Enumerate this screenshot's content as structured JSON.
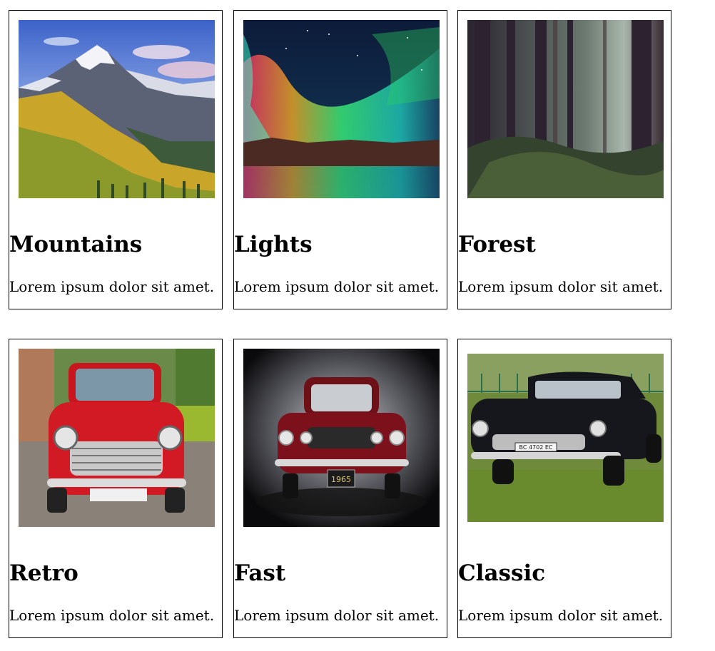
{
  "cards": [
    {
      "title": "Mountains",
      "text": "Lorem ipsum dolor sit amet.",
      "image": "mountains-photo"
    },
    {
      "title": "Lights",
      "text": "Lorem ipsum dolor sit amet.",
      "image": "aurora-photo"
    },
    {
      "title": "Forest",
      "text": "Lorem ipsum dolor sit amet.",
      "image": "forest-photo"
    },
    {
      "title": "Retro",
      "text": "Lorem ipsum dolor sit amet.",
      "image": "red-mini-car-photo"
    },
    {
      "title": "Fast",
      "text": "Lorem ipsum dolor sit amet.",
      "image": "red-mustang-photo"
    },
    {
      "title": "Classic",
      "text": "Lorem ipsum dolor sit amet.",
      "image": "black-classic-car-photo",
      "plate": "BC 4702 EC"
    }
  ],
  "mustang_plate": "1965",
  "colors": {
    "border": "#000000",
    "background": "#ffffff",
    "text": "#000000"
  }
}
